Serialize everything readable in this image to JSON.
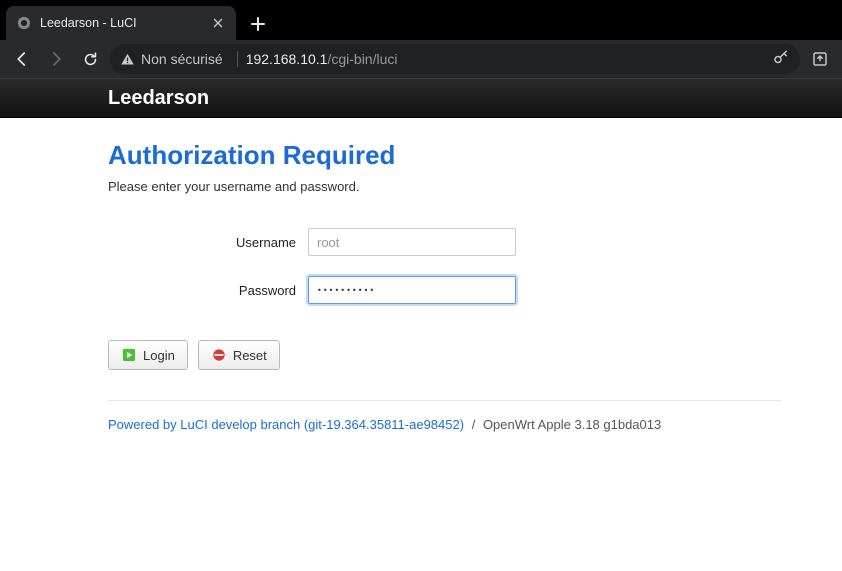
{
  "browser": {
    "tab_title": "Leedarson - LuCI",
    "security_label": "Non sécurisé",
    "url_host": "192.168.10.1",
    "url_path": "/cgi-bin/luci"
  },
  "header": {
    "brand": "Leedarson"
  },
  "auth": {
    "heading": "Authorization Required",
    "subtitle": "Please enter your username and password.",
    "username_label": "Username",
    "username_placeholder": "root",
    "username_value": "root",
    "password_label": "Password",
    "password_value": "••••••••••",
    "login_label": "Login",
    "reset_label": "Reset"
  },
  "footer": {
    "luci_link_text": "Powered by LuCI develop branch (git-19.364.35811-ae98452)",
    "separator": "/",
    "firmware_text": "OpenWrt Apple 3.18 g1bda013"
  }
}
